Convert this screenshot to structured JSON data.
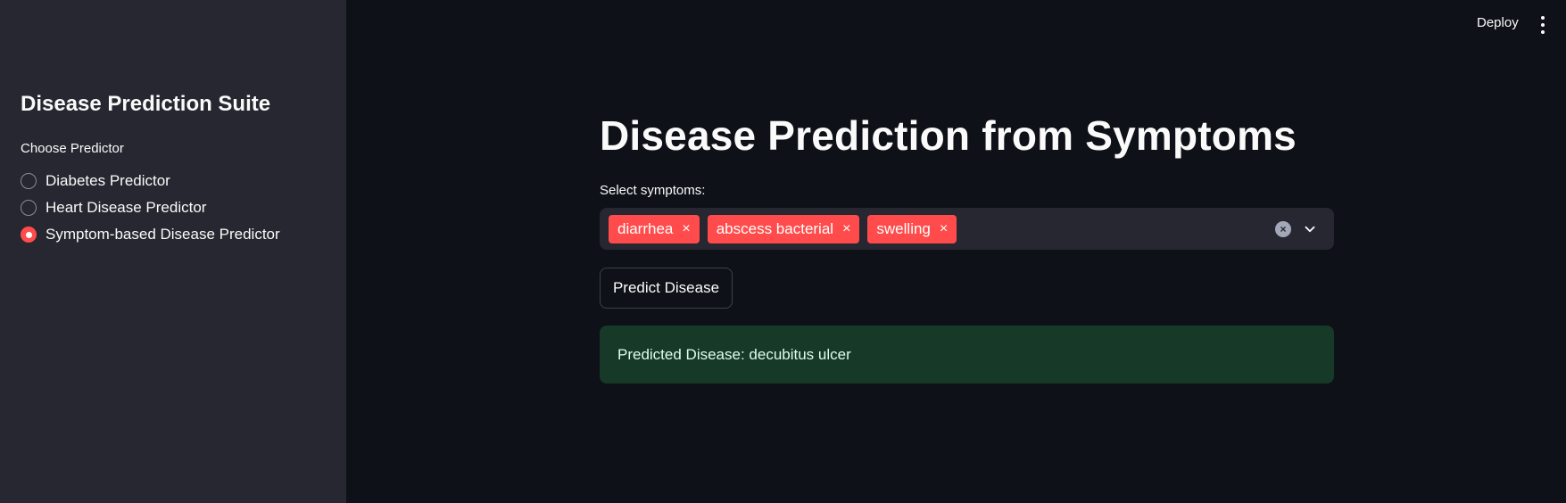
{
  "header": {
    "deploy_label": "Deploy",
    "menu_icon": "more-vertical-icon"
  },
  "sidebar": {
    "title": "Disease Prediction Suite",
    "radio_label": "Choose Predictor",
    "options": [
      {
        "label": "Diabetes Predictor",
        "selected": false
      },
      {
        "label": "Heart Disease Predictor",
        "selected": false
      },
      {
        "label": "Symptom-based Disease Predictor",
        "selected": true
      }
    ]
  },
  "main": {
    "title": "Disease Prediction from Symptoms",
    "symptoms_label": "Select symptoms:",
    "selected_symptoms": [
      "diarrhea",
      "abscess bacterial",
      "swelling"
    ],
    "tag_remove_glyph": "×",
    "clear_glyph": "×",
    "predict_button_label": "Predict Disease",
    "result_text": "Predicted Disease: decubitus ulcer"
  },
  "colors": {
    "accent": "#ff4b4b",
    "background": "#0e1117",
    "sidebar_bg": "#262730",
    "success_bg": "#173928",
    "success_text": "#dffde9"
  }
}
